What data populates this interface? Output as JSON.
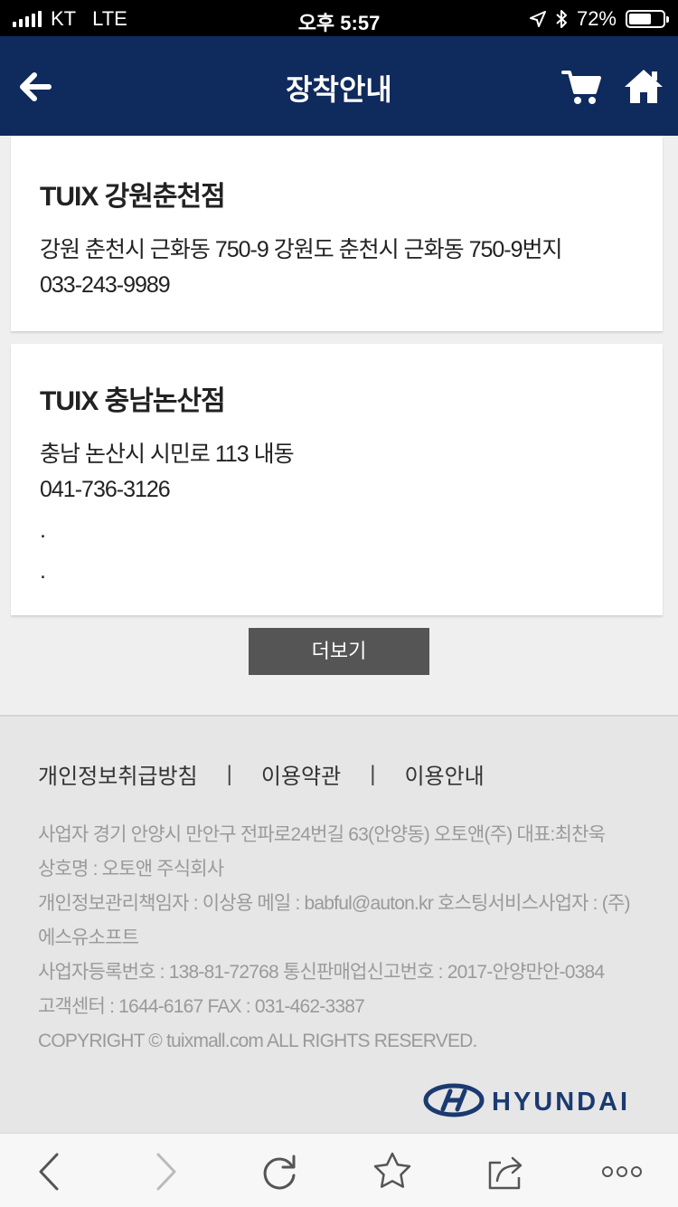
{
  "status_bar": {
    "carrier": "KT",
    "network": "LTE",
    "time": "오후 5:57",
    "battery": "72%",
    "battery_level": 0.72
  },
  "header": {
    "title": "장착안내",
    "back_icon": "arrow-left-icon",
    "cart_icon": "cart-icon",
    "home_icon": "home-icon"
  },
  "stores": [
    {
      "name": "TUIX 강원춘천점",
      "address": "강원 춘천시 근화동 750-9 강원도 춘천시 근화동 750-9번지",
      "phone": "033-243-9989"
    },
    {
      "name": "TUIX 충남논산점",
      "address": "충남 논산시 시민로 113 내동",
      "phone": "041-736-3126",
      "extra1": ".",
      "extra2": "."
    }
  ],
  "more_button": "더보기",
  "footer": {
    "links": [
      "개인정보취급방침",
      "이용약관",
      "이용안내"
    ],
    "separator": "|",
    "info": [
      "사업자 경기 안양시 만안구 전파로24번길 63(안양동) 오토앤(주) 대표:최찬욱",
      "상호명 : 오토앤 주식회사",
      "개인정보관리책임자 : 이상용 메일 : babful@auton.kr 호스팅서비스사업자 : (주)",
      "에스유소프트",
      "사업자등록번호 : 138-81-72768 통신판매업신고번호 : 2017-안양만안-0384",
      "고객센터 : 1644-6167 FAX : 031-462-3387",
      "COPYRIGHT © tuixmall.com ALL RIGHTS RESERVED."
    ],
    "brand": "HYUNDAI"
  },
  "colors": {
    "header_bg": "#0f2a5c",
    "more_button_bg": "#555555",
    "brand_logo": "#1b3a70"
  }
}
